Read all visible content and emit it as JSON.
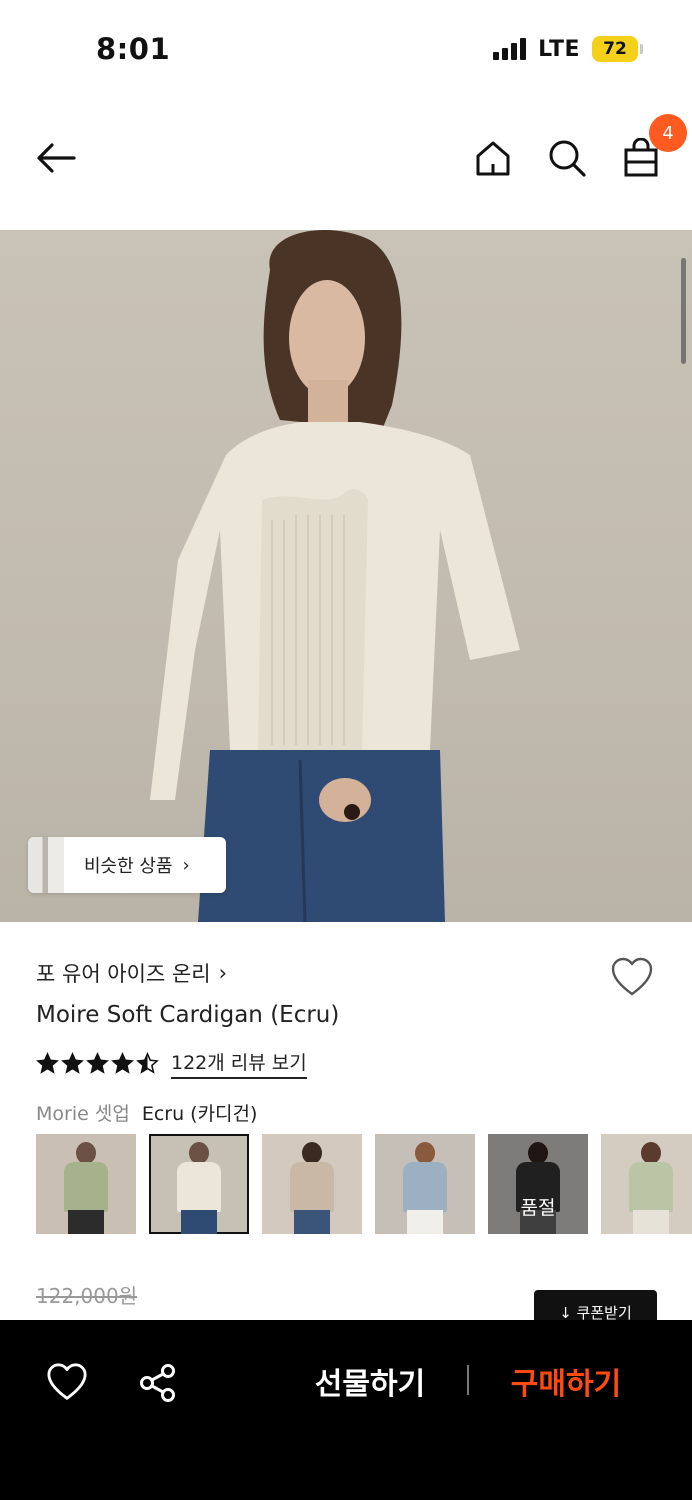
{
  "status_bar": {
    "time": "8:01",
    "network": "LTE",
    "battery": "72"
  },
  "nav": {
    "back_icon": "arrow-left-icon",
    "home_icon": "home-icon",
    "search_icon": "search-icon",
    "cart_icon": "shopping-bag-icon",
    "cart_count": "4"
  },
  "product": {
    "similar_label": "비슷한 상품",
    "similar_arrow": "›",
    "brand": "포 유어 아이즈 온리",
    "brand_arrow": "›",
    "title": "Moire Soft Cardigan (Ecru)",
    "rating": 4.5,
    "review_link": "122개 리뷰 보기",
    "option_group": "Morie 셋업",
    "option_value": "Ecru (카디건)",
    "soldout_label": "품절",
    "price_original": "122,000원",
    "coupon_label": "↓ 쿠폰받기"
  },
  "colors": {
    "accent": "#ff5a1f",
    "buy": "#ff4a12",
    "battery": "#f5d01a"
  },
  "bottom_bar": {
    "wish_icon": "heart-icon",
    "share_icon": "share-icon",
    "gift_label": "선물하기",
    "buy_label": "구매하기"
  }
}
